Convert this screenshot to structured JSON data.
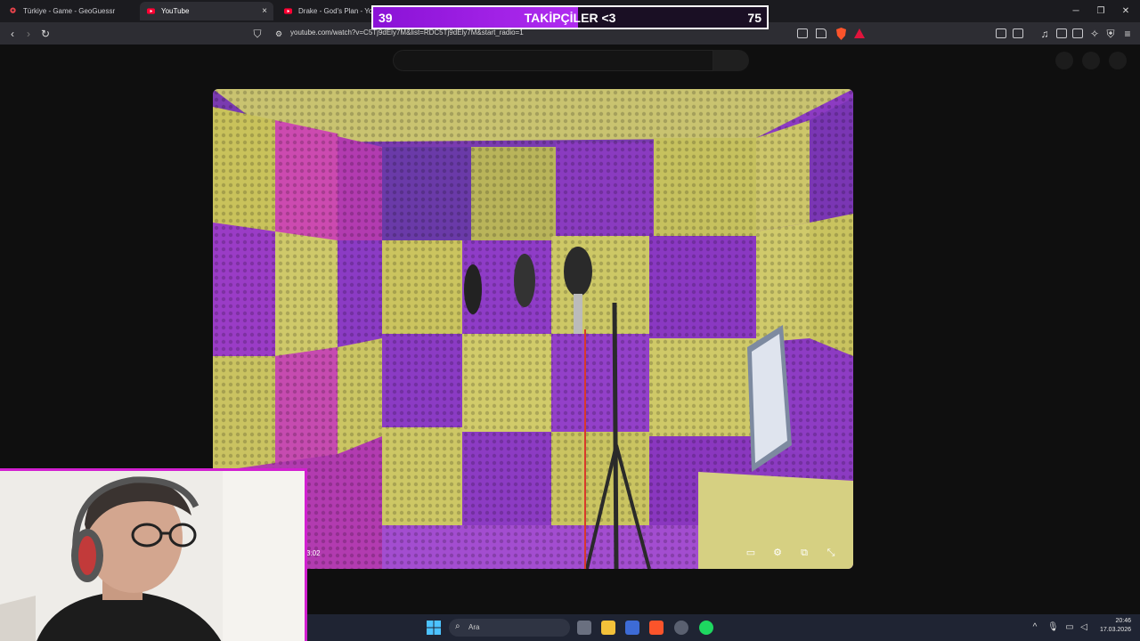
{
  "browser": {
    "tabs": [
      {
        "label": "Türkiye - Game - GeoGuessr",
        "icon": "geoguessr-pin-icon",
        "color": "#e8434b"
      },
      {
        "label": "YouTube",
        "icon": "youtube-icon",
        "color": "#ff0033",
        "active": true
      },
      {
        "label": "Drake - God's Plan - YouTu",
        "icon": "youtube-icon",
        "color": "#ff0033"
      }
    ],
    "close_glyph": "×",
    "url": "youtube.com/watch?v=C5Tj9dEly7M&list=RDC5Tj9dEly7M&start_radio=1"
  },
  "follower_goal": {
    "current": "39",
    "label": "TAKİPÇİLER <3",
    "goal": "75",
    "progress": 0.52
  },
  "player": {
    "time": "3:02",
    "controls": [
      "subtitles-icon",
      "settings-icon",
      "miniplayer-icon",
      "fullscreen-icon"
    ]
  },
  "taskbar": {
    "search_placeholder": "Ara",
    "time": "20:46",
    "date": "17.03.2026"
  }
}
